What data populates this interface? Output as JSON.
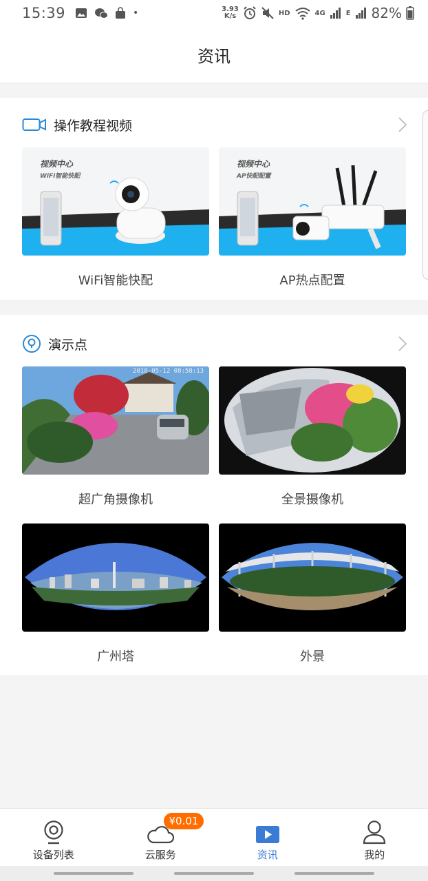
{
  "status_bar": {
    "time": "15:39",
    "net_speed_value": "3.93",
    "net_speed_unit": "K/s",
    "hd_label": "HD",
    "lte_label": "4G",
    "e_label": "E",
    "battery": "82%"
  },
  "header": {
    "title": "资讯"
  },
  "tutorial": {
    "title": "操作教程视频",
    "items": [
      {
        "caption": "WiFi智能快配",
        "thumb_title": "视频中心",
        "thumb_subtitle": "WiFi智能快配"
      },
      {
        "caption": "AP热点配置",
        "thumb_title": "视频中心",
        "thumb_subtitle": "AP快配配置"
      }
    ]
  },
  "demo": {
    "title": "演示点",
    "items": [
      {
        "caption": "超广角摄像机",
        "overlay": "2018-05-12 08:58:13"
      },
      {
        "caption": "全景摄像机"
      },
      {
        "caption": "广州塔"
      },
      {
        "caption": "外景"
      }
    ]
  },
  "tabbar": {
    "tabs": [
      {
        "label": "设备列表"
      },
      {
        "label": "云服务",
        "badge": "¥0.01"
      },
      {
        "label": "资讯"
      },
      {
        "label": "我的"
      }
    ]
  },
  "colors": {
    "accent": "#3a7bd5",
    "badge": "#ff6d00",
    "promo_blue": "#1fb0f0"
  }
}
